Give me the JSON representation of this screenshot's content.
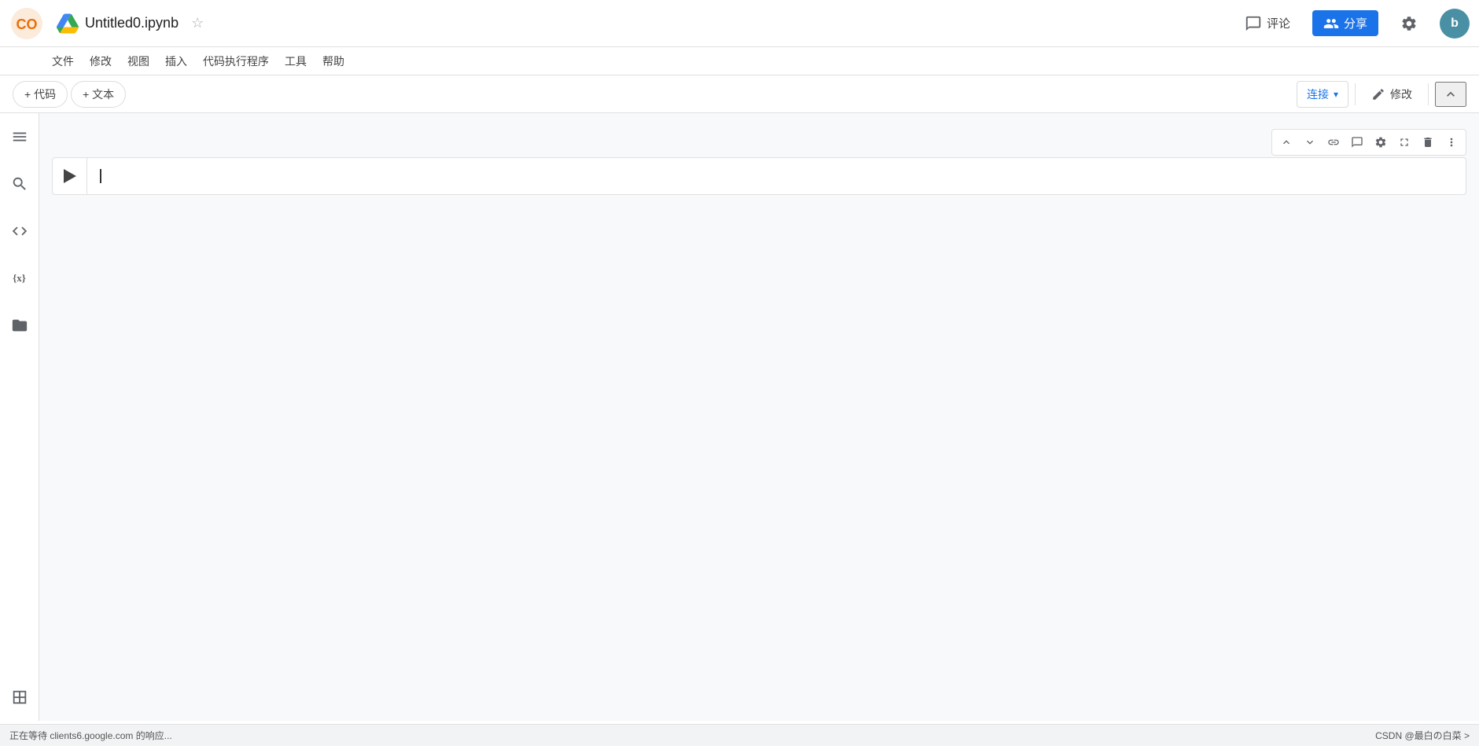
{
  "header": {
    "logo_text": "CO",
    "title": "Untitled0.ipynb",
    "star_label": "☆",
    "comment_label": "评论",
    "share_label": "分享",
    "settings_label": "⚙",
    "user_avatar": "b"
  },
  "menubar": {
    "items": [
      "文件",
      "修改",
      "视图",
      "插入",
      "代码执行程序",
      "工具",
      "帮助"
    ]
  },
  "toolbar": {
    "add_code_label": "+ 代码",
    "add_text_label": "+ 文本",
    "connect_label": "连接",
    "edit_label": "修改",
    "collapse_label": "∧"
  },
  "sidebar": {
    "icons": [
      {
        "name": "menu-icon",
        "symbol": "☰"
      },
      {
        "name": "search-icon",
        "symbol": "🔍"
      },
      {
        "name": "code-icon",
        "symbol": "<>"
      },
      {
        "name": "variable-icon",
        "symbol": "{x}"
      },
      {
        "name": "folder-icon",
        "symbol": "🗁"
      },
      {
        "name": "table-icon",
        "symbol": "⊞"
      }
    ]
  },
  "cell": {
    "run_button_title": "运行单元格",
    "content": ""
  },
  "cell_actions": {
    "move_up": "↑",
    "move_down": "↓",
    "link": "🔗",
    "comment": "💬",
    "settings": "⚙",
    "expand": "⬒",
    "delete": "🗑",
    "more": "⋮"
  },
  "statusbar": {
    "loading_text": "正在等待 clients6.google.com 的响应...",
    "csdn_text": "CSDN @最白の白菜 >"
  }
}
